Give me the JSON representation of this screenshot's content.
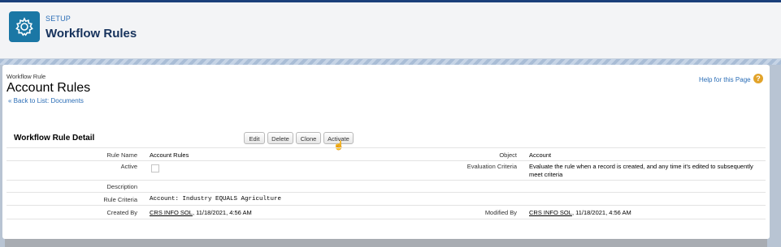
{
  "header": {
    "eyebrow": "SETUP",
    "title": "Workflow Rules",
    "icon": "gear-icon"
  },
  "page": {
    "type": "Workflow Rule",
    "title": "Account Rules",
    "back_link": "« Back to List: Documents",
    "help_link": "Help for this Page",
    "help_icon": "?"
  },
  "detail": {
    "title": "Workflow Rule Detail",
    "buttons": {
      "edit": "Edit",
      "delete": "Delete",
      "clone": "Clone",
      "activate": "Activate"
    },
    "fields": {
      "rule_name": {
        "label": "Rule Name",
        "value": "Account Rules"
      },
      "active": {
        "label": "Active",
        "checked": false
      },
      "description": {
        "label": "Description",
        "value": ""
      },
      "rule_criteria": {
        "label": "Rule Criteria",
        "value": "Account: Industry EQUALS Agriculture"
      },
      "created_by": {
        "label": "Created By",
        "user": "CRS INFO SOL",
        "date": ", 11/18/2021, 4:56 AM"
      },
      "object": {
        "label": "Object",
        "value": "Account"
      },
      "evaluation_criteria": {
        "label": "Evaluation Criteria",
        "value": "Evaluate the rule when a record is created, and any time it's edited to subsequently meet criteria"
      },
      "modified_by": {
        "label": "Modified By",
        "user": "CRS INFO SOL",
        "date": ", 11/18/2021, 4:56 AM"
      }
    }
  },
  "colors": {
    "brand": "#1b77a5",
    "link": "#2a6db6",
    "title": "#16325c"
  }
}
